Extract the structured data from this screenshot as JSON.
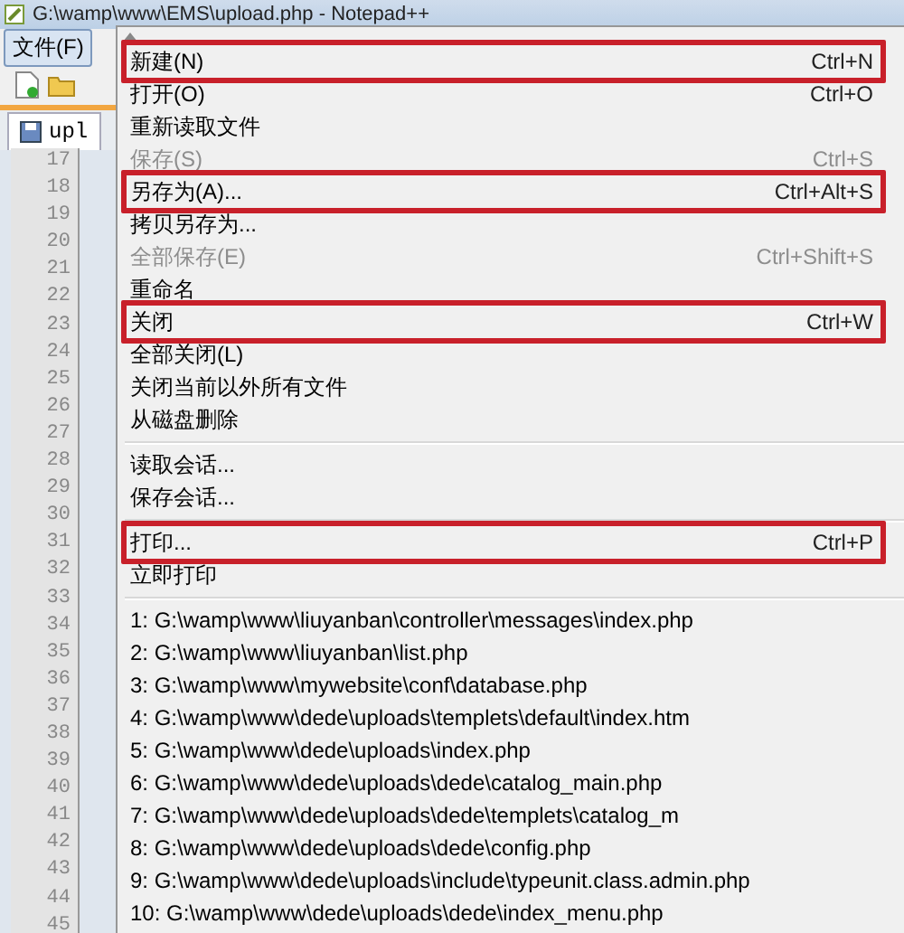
{
  "window": {
    "title": "G:\\wamp\\www\\EMS\\upload.php - Notepad++"
  },
  "menu_bar": [
    {
      "label": "文件(F)",
      "selected": true
    }
  ],
  "tab": {
    "label": "upl"
  },
  "line_numbers": [
    "17",
    "18",
    "19",
    "20",
    "21",
    "22",
    "23",
    "24",
    "25",
    "26",
    "27",
    "28",
    "29",
    "30",
    "31",
    "32",
    "33",
    "34",
    "35",
    "36",
    "37",
    "38",
    "39",
    "40",
    "41",
    "42",
    "43",
    "44",
    "45"
  ],
  "file_menu": [
    {
      "kind": "command",
      "label": "新建(N)",
      "shortcut": "Ctrl+N",
      "disabled": false,
      "highlighted": true
    },
    {
      "kind": "command",
      "label": "打开(O)",
      "shortcut": "Ctrl+O",
      "disabled": false,
      "highlighted": false
    },
    {
      "kind": "command",
      "label": "重新读取文件",
      "disabled": false,
      "highlighted": false
    },
    {
      "kind": "command",
      "label": "保存(S)",
      "shortcut": "Ctrl+S",
      "disabled": true,
      "highlighted": false
    },
    {
      "kind": "command",
      "label": "另存为(A)...",
      "shortcut": "Ctrl+Alt+S",
      "disabled": false,
      "highlighted": true
    },
    {
      "kind": "command",
      "label": "拷贝另存为...",
      "disabled": false,
      "highlighted": false
    },
    {
      "kind": "command",
      "label": "全部保存(E)",
      "shortcut": "Ctrl+Shift+S",
      "disabled": true,
      "highlighted": false
    },
    {
      "kind": "command",
      "label": "重命名",
      "disabled": false,
      "highlighted": false
    },
    {
      "kind": "command",
      "label": "关闭",
      "shortcut": "Ctrl+W",
      "disabled": false,
      "highlighted": true
    },
    {
      "kind": "command",
      "label": "全部关闭(L)",
      "disabled": false,
      "highlighted": false
    },
    {
      "kind": "command",
      "label": "关闭当前以外所有文件",
      "disabled": false,
      "highlighted": false
    },
    {
      "kind": "command",
      "label": "从磁盘删除",
      "disabled": false,
      "highlighted": false
    },
    {
      "kind": "separator"
    },
    {
      "kind": "command",
      "label": "读取会话...",
      "disabled": false,
      "highlighted": false
    },
    {
      "kind": "command",
      "label": "保存会话...",
      "disabled": false,
      "highlighted": false
    },
    {
      "kind": "separator"
    },
    {
      "kind": "command",
      "label": "打印...",
      "shortcut": "Ctrl+P",
      "disabled": false,
      "highlighted": true
    },
    {
      "kind": "command",
      "label": "立即打印",
      "disabled": false,
      "highlighted": false
    },
    {
      "kind": "separator"
    },
    {
      "kind": "recent",
      "label": "1: G:\\wamp\\www\\liuyanban\\controller\\messages\\index.php"
    },
    {
      "kind": "recent",
      "label": "2: G:\\wamp\\www\\liuyanban\\list.php"
    },
    {
      "kind": "recent",
      "label": "3: G:\\wamp\\www\\mywebsite\\conf\\database.php"
    },
    {
      "kind": "recent",
      "label": "4: G:\\wamp\\www\\dede\\uploads\\templets\\default\\index.htm"
    },
    {
      "kind": "recent",
      "label": "5: G:\\wamp\\www\\dede\\uploads\\index.php"
    },
    {
      "kind": "recent",
      "label": "6: G:\\wamp\\www\\dede\\uploads\\dede\\catalog_main.php"
    },
    {
      "kind": "recent",
      "label": "7: G:\\wamp\\www\\dede\\uploads\\dede\\templets\\catalog_m"
    },
    {
      "kind": "recent",
      "label": "8: G:\\wamp\\www\\dede\\uploads\\dede\\config.php"
    },
    {
      "kind": "recent",
      "label": "9: G:\\wamp\\www\\dede\\uploads\\include\\typeunit.class.admin.php"
    },
    {
      "kind": "recent",
      "label": "10: G:\\wamp\\www\\dede\\uploads\\dede\\index_menu.php"
    }
  ]
}
